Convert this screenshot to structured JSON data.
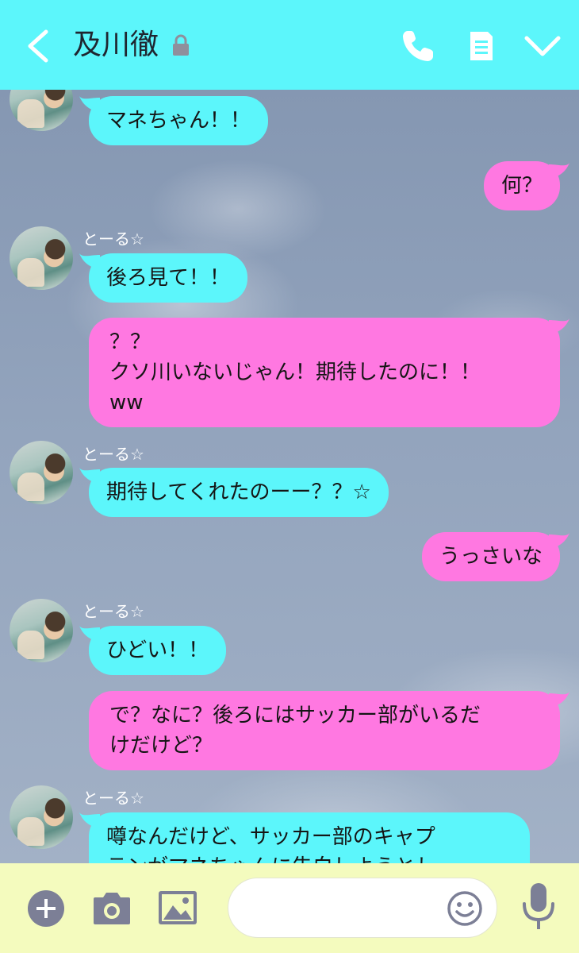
{
  "header": {
    "title": "及川徹",
    "background": "#5cf6fb",
    "icons": [
      "chevron-left-icon",
      "lock-icon",
      "phone-icon",
      "notes-icon",
      "chevron-down-icon"
    ]
  },
  "chat": {
    "incoming_color": "#5cf6fb",
    "outgoing_color": "#ff78e1",
    "messages": [
      {
        "side": "in",
        "sender": "",
        "text": "マネちゃん！！"
      },
      {
        "side": "out",
        "text": "何？"
      },
      {
        "side": "in",
        "sender": "とーる☆",
        "text": "後ろ見て！！"
      },
      {
        "side": "out",
        "text": "？？\nクソ川いないじゃん！期待したのに！！\nww"
      },
      {
        "side": "in",
        "sender": "とーる☆",
        "text": "期待してくれたのーー？？☆"
      },
      {
        "side": "out",
        "text": "うっさいな"
      },
      {
        "side": "in",
        "sender": "とーる☆",
        "text": "ひどい！！"
      },
      {
        "side": "out",
        "text": "で？なに？後ろにはサッカー部がいるだ\nけだけど？"
      },
      {
        "side": "in",
        "sender": "とーる☆",
        "text": "噂なんだけど、サッカー部のキャプ\nテンがマネちゃんに告白しようとし"
      }
    ]
  },
  "input_bar": {
    "background": "#f4fbbe",
    "placeholder": "",
    "icons": [
      "plus-icon",
      "camera-icon",
      "image-icon",
      "emoji-icon",
      "microphone-icon"
    ]
  }
}
